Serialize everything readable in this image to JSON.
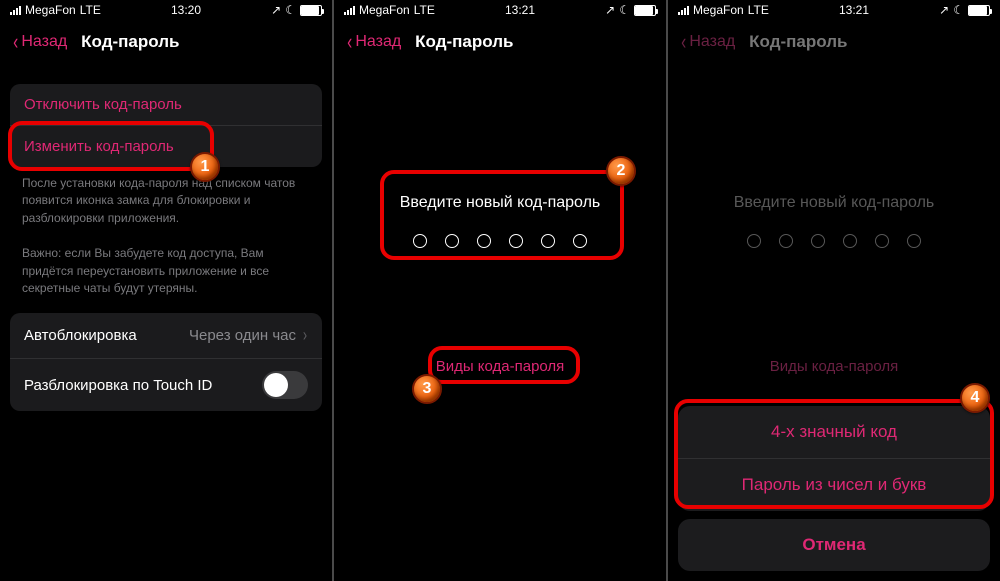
{
  "status": {
    "carrier": "MegaFon",
    "network": "LTE",
    "time1": "13:20",
    "time2": "13:21",
    "time3": "13:21"
  },
  "nav": {
    "back": "Назад",
    "title": "Код-пароль"
  },
  "screen1": {
    "disable": "Отключить код-пароль",
    "change": "Изменить код-пароль",
    "note1": "После установки кода-пароля над списком чатов появится иконка замка для блокировки и разблокировки приложения.",
    "note2": "Важно: если Вы забудете код доступа, Вам придётся переустановить приложение и все секретные чаты будут утеряны.",
    "autolock_label": "Автоблокировка",
    "autolock_value": "Через один час",
    "touchid": "Разблокировка по Touch ID"
  },
  "screen2": {
    "prompt": "Введите новый код-пароль",
    "types": "Виды кода-пароля"
  },
  "screen3": {
    "prompt": "Введите новый код-пароль",
    "types": "Виды кода-пароля",
    "opt1": "4-х значный код",
    "opt2": "Пароль из чисел и букв",
    "cancel": "Отмена"
  },
  "badges": {
    "b1": "1",
    "b2": "2",
    "b3": "3",
    "b4": "4"
  }
}
